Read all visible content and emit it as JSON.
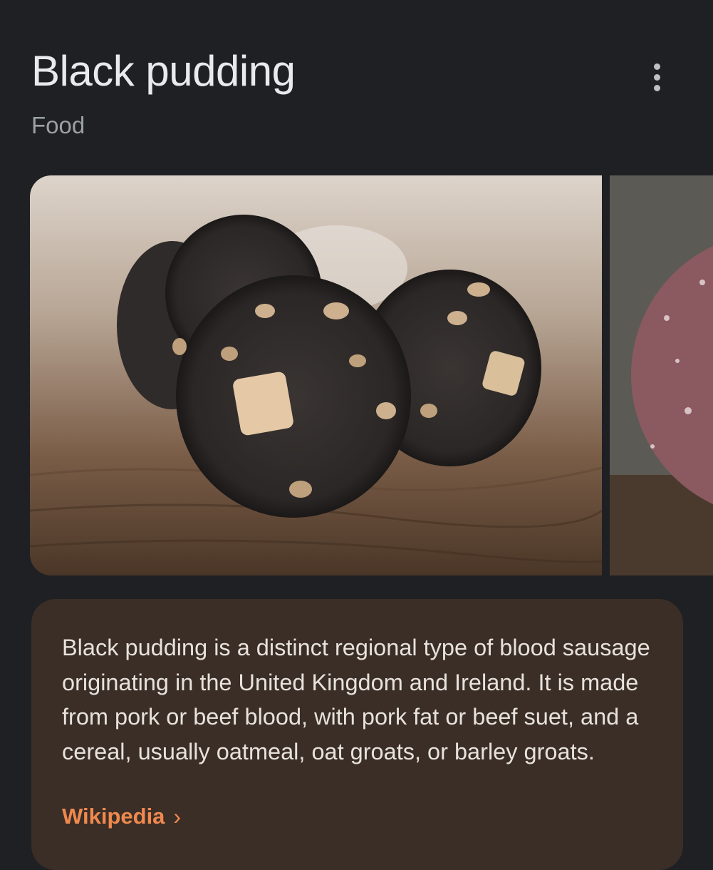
{
  "header": {
    "title": "Black pudding",
    "subtitle": "Food",
    "more_icon": "more-vert-icon"
  },
  "images": {
    "main_subject": "black pudding slices on wooden board",
    "second_subject": "sliced blood sausage"
  },
  "description": {
    "text": "Black pudding is a distinct regional type of blood sausage originating in the United Kingdom and Ireland. It is made from pork or beef blood, with pork fat or beef suet, and a cereal, usually oatmeal, oat groats, or barley groats.",
    "source_label": "Wikipedia",
    "source_chevron": "›"
  },
  "colors": {
    "background": "#1f2023",
    "card": "#3a2e27",
    "link": "#f0894e"
  }
}
